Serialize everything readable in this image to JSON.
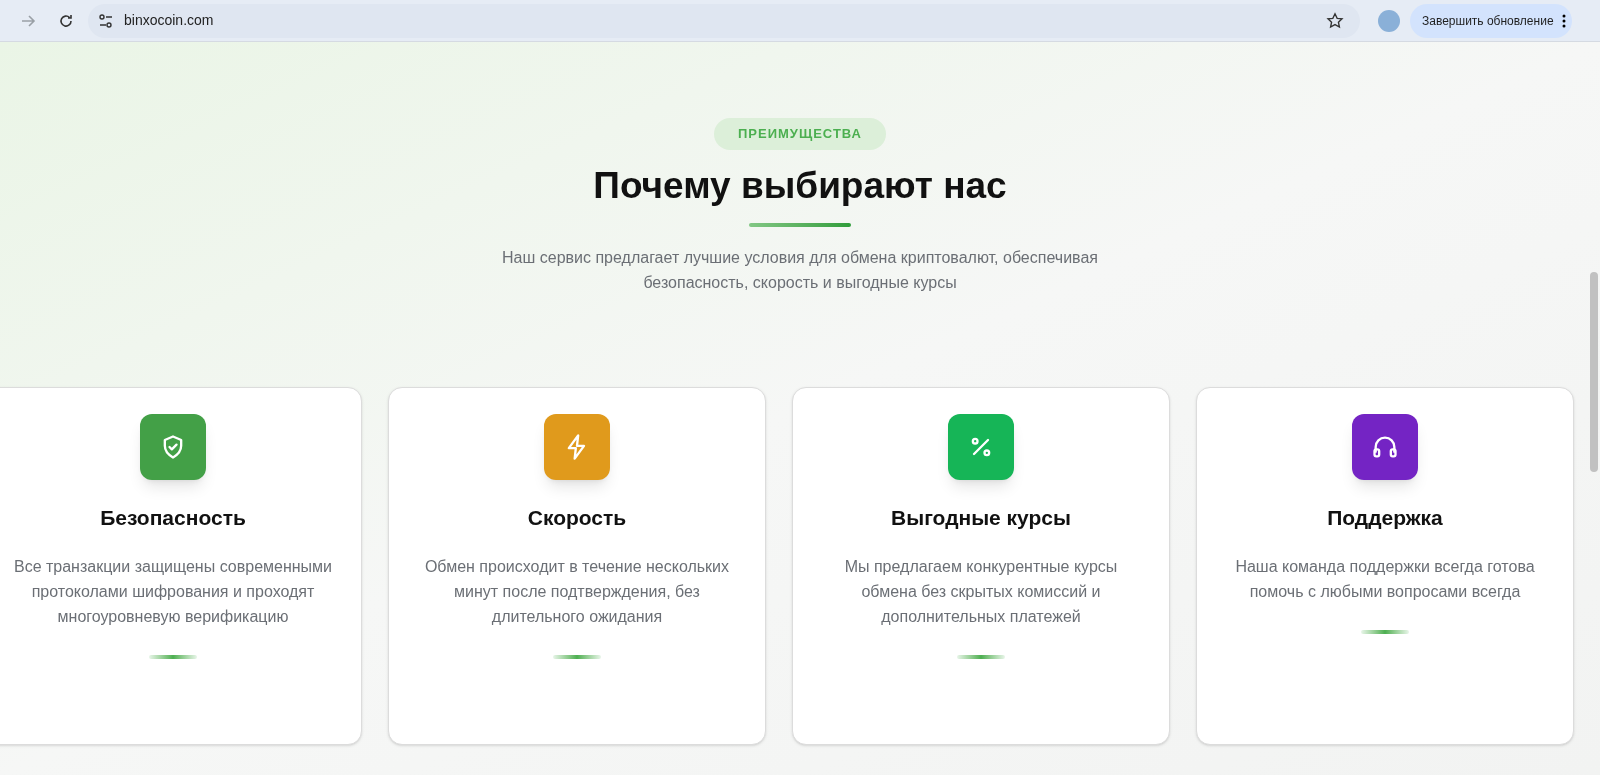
{
  "browser": {
    "url": "binxocoin.com",
    "update_button": "Завершить обновление",
    "back_disabled": true
  },
  "section": {
    "badge": "ПРЕИМУЩЕСТВА",
    "title": "Почему выбирают нас",
    "subtitle": "Наш сервис предлагает лучшие условия для обмена криптовалют, обеспечивая безопасность, скорость и выгодные курсы"
  },
  "features": [
    {
      "kind": "shield",
      "color": "#43a047",
      "title": "Безопасность",
      "text": "Все транзакции защищены современными протоколами шифрования и проходят многоуровневую верификацию"
    },
    {
      "kind": "bolt",
      "color": "#e09a1c",
      "title": "Скорость",
      "text": "Обмен происходит в течение нескольких минут после подтверждения, без длительного ожидания"
    },
    {
      "kind": "percent",
      "color": "#16b557",
      "title": "Выгодные курсы",
      "text": "Мы предлагаем конкурентные курсы обмена без скрытых комиссий и дополнительных платежей"
    },
    {
      "kind": "headset",
      "color": "#7424c4",
      "title": "Поддержка",
      "text": "Наша команда поддержки всегда готова помочь с любыми вопросами всегда"
    }
  ]
}
